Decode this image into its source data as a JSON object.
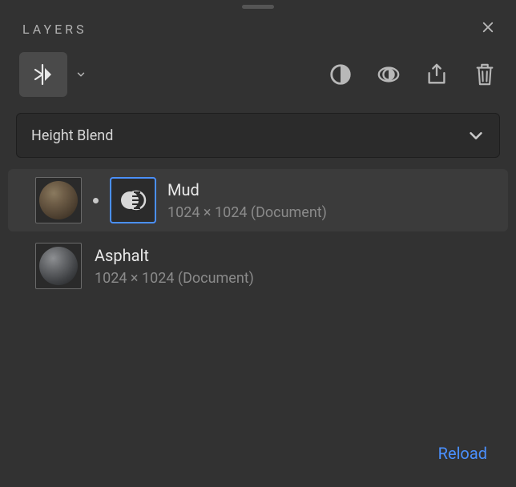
{
  "panel": {
    "title": "LAYERS"
  },
  "blend": {
    "mode": "Height Blend"
  },
  "layers": [
    {
      "name": "Mud",
      "meta": "1024 × 1024 (Document)"
    },
    {
      "name": "Asphalt",
      "meta": "1024 × 1024 (Document)"
    }
  ],
  "footer": {
    "reload": "Reload"
  }
}
